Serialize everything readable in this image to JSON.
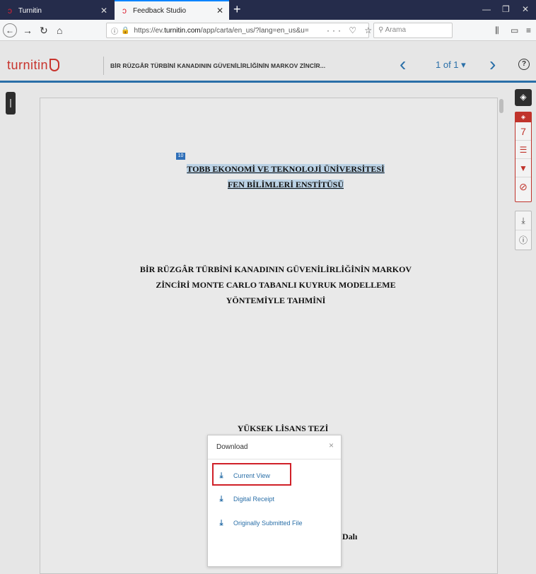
{
  "browser": {
    "tabs": [
      {
        "label": "Turnitin",
        "icon": "turnitin-tab-icon"
      },
      {
        "label": "Feedback Studio",
        "icon": "turnitin-tab-icon",
        "active": true
      }
    ],
    "url_prefix": "https://ev.",
    "url_domain": "turnitin.com",
    "url_rest": "/app/carta/en_us/?lang=en_us&u=",
    "search_placeholder": "Arama",
    "url_actions": "··· ♡ ☆"
  },
  "header": {
    "logo_text": "turnitin",
    "document_title": "BİR RÜZGÂR TÜRBİNİ KANADININ GÜVENİLİRLİĞİNİN MARKOV ZİNCİR...",
    "page_indicator": "1 of 1 ▾",
    "help": "?"
  },
  "document": {
    "match_number": "10",
    "institution_line1": "TOBB EKONOMİ VE TEKNOLOJİ ÜNİVERSİTESİ",
    "institution_line2": "FEN BİLİMLERİ ENSTİTÜSÜ",
    "title_line1": "BİR RÜZGÂR TÜRBİNİ KANADININ GÜVENİLİRLİĞİNİN MARKOV",
    "title_line2": "ZİNCİRİ MONTE CARLO TABANLI KUYRUK MODELLEME",
    "title_line3": "YÖNTEMİYLE TAHMİNİ",
    "thesis_type": "YÜKSEK LİSANS TEZİ",
    "department_fragment": "Dalı"
  },
  "right_toolbar": {
    "similarity_count": "7"
  },
  "download_popup": {
    "title": "Download",
    "close": "×",
    "items": [
      "Current View",
      "Digital Receipt",
      "Originally Submitted File"
    ]
  },
  "colors": {
    "brand_red": "#c8342d",
    "link_blue": "#2a6fa8",
    "highlight_box": "#d02028"
  }
}
